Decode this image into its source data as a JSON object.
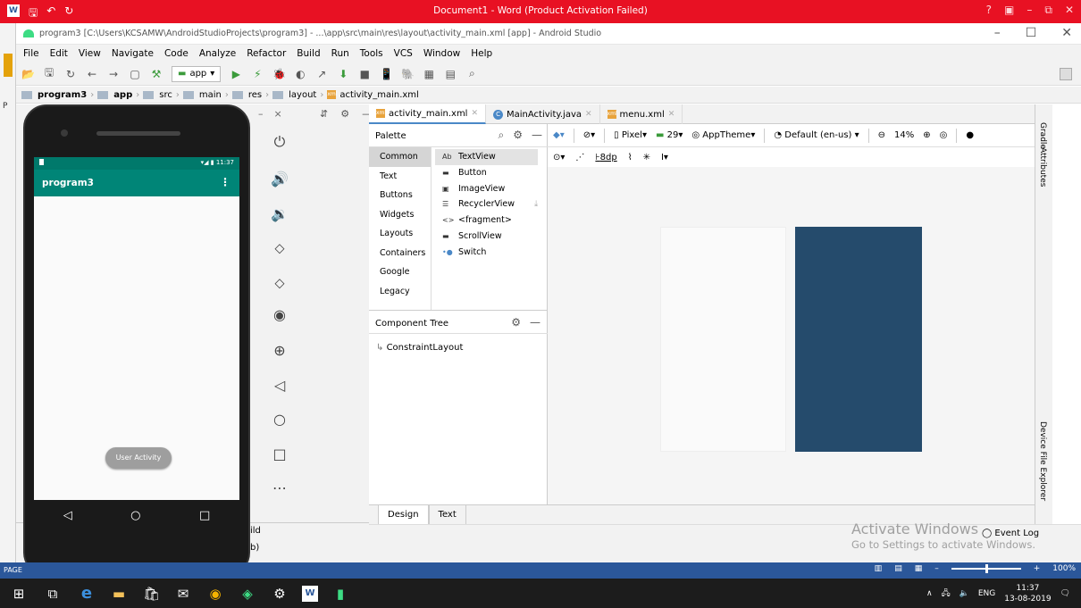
{
  "word": {
    "title": "Document1 - Word (Product Activation Failed)",
    "logo": "W",
    "quick_access": [
      "save-icon",
      "undo-icon",
      "redo-icon"
    ],
    "controls": [
      "?",
      "▣",
      "–",
      "⧉",
      "✕"
    ],
    "left_letter": "P",
    "status": {
      "page": "PAGE",
      "zoom": "100%",
      "zoom_minus": "–",
      "zoom_plus": "+"
    }
  },
  "as": {
    "title": "program3 [C:\\Users\\KCSAMW\\AndroidStudioProjects\\program3] - ...\\app\\src\\main\\res\\layout\\activity_main.xml [app] - Android Studio",
    "menus": [
      "File",
      "Edit",
      "View",
      "Navigate",
      "Code",
      "Analyze",
      "Refactor",
      "Build",
      "Run",
      "Tools",
      "VCS",
      "Window",
      "Help"
    ],
    "toolbar": {
      "app_selector": "app"
    },
    "breadcrumb": [
      "program3",
      "app",
      "src",
      "main",
      "res",
      "layout",
      "activity_main.xml"
    ],
    "tabs": [
      {
        "label": "activity_main.xml",
        "icon": "xml-icon",
        "active": true
      },
      {
        "label": "MainActivity.java",
        "icon": "class-icon",
        "active": false
      },
      {
        "label": "menu.xml",
        "icon": "xml-icon",
        "active": false
      }
    ],
    "palette": {
      "title": "Palette",
      "categories": [
        "Common",
        "Text",
        "Buttons",
        "Widgets",
        "Layouts",
        "Containers",
        "Google",
        "Legacy"
      ],
      "selected_category": "Common",
      "items": [
        {
          "glyph": "Ab",
          "label": "TextView"
        },
        {
          "glyph": "▬",
          "label": "Button"
        },
        {
          "glyph": "▣",
          "label": "ImageView"
        },
        {
          "glyph": "☰",
          "label": "RecyclerView"
        },
        {
          "glyph": "<>",
          "label": "<fragment>"
        },
        {
          "glyph": "▬",
          "label": "ScrollView"
        },
        {
          "glyph": "•●",
          "label": "Switch"
        }
      ]
    },
    "component_tree": {
      "title": "Component Tree",
      "root": "ConstraintLayout"
    },
    "design_toolbar": {
      "device": "Pixel",
      "api": "29",
      "theme": "AppTheme",
      "locale": "Default (en-us)",
      "zoom": "14%",
      "margin": "8dp"
    },
    "design_tabs": [
      "Design",
      "Text"
    ],
    "side_tools": [
      "Gradle",
      "Attributes",
      "Device File Explorer"
    ],
    "bottom_left": [
      "ild",
      "b)"
    ],
    "event_log": "Event Log",
    "activate_windows": "Activate Windows",
    "activate_hint": "Go to Settings to activate Windows."
  },
  "emulator": {
    "panel_controls": [
      "–",
      "×"
    ],
    "status_time": "11:37",
    "app_title": "program3",
    "overflow": "⋮",
    "button_label": "User Activity",
    "nav": [
      "◁",
      "○",
      "□"
    ],
    "side_icons": [
      "power-icon",
      "volume-up-icon",
      "volume-down-icon",
      "rotate-left-icon",
      "rotate-right-icon",
      "camera-icon",
      "zoom-icon",
      "back-icon",
      "home-icon",
      "overview-icon",
      "more-icon"
    ],
    "side_glyphs": [
      "⏻",
      "🔊",
      "🔉",
      "⬦",
      "⬦",
      "◉",
      "⊕",
      "◁",
      "○",
      "□",
      "⋯"
    ]
  },
  "taskbar": {
    "lang": "ENG",
    "time": "11:37",
    "date": "13-08-2019"
  },
  "colors": {
    "word_red": "#e81123",
    "word_blue": "#2b579a",
    "app_bar": "#008577",
    "blueprint": "#254b6c"
  }
}
